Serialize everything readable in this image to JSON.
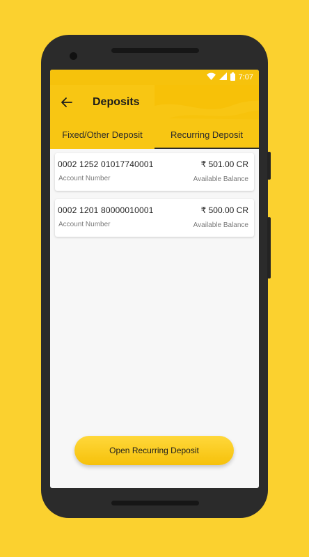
{
  "status_bar": {
    "time": "7:07"
  },
  "app_bar": {
    "title": "Deposits"
  },
  "tabs": [
    {
      "label": "Fixed/Other Deposit",
      "active": false
    },
    {
      "label": "Recurring Deposit",
      "active": true
    }
  ],
  "accounts": [
    {
      "number": "0002 1252 01017740001",
      "number_label": "Account Number",
      "balance": "₹ 501.00 CR",
      "balance_label": "Available Balance"
    },
    {
      "number": "0002 1201 80000010001",
      "number_label": "Account Number",
      "balance": "₹ 500.00 CR",
      "balance_label": "Available Balance"
    }
  ],
  "cta": {
    "label": "Open Recurring Deposit"
  },
  "colors": {
    "accent": "#F8C613",
    "background": "#FBD12F"
  }
}
